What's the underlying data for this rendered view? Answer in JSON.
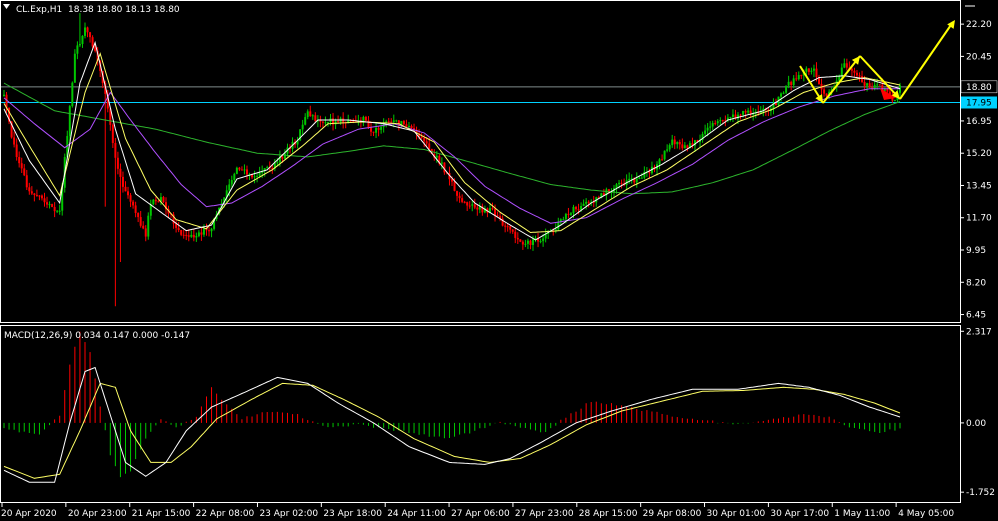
{
  "window": {
    "symbol": "CL.Exp,H1",
    "ohlc": "18.38 18.80 18.13 18.80",
    "menu_icon": "dropdown-triangle-icon"
  },
  "price_axis": {
    "ticks": [
      "22.20",
      "20.45",
      "18.80",
      "16.95",
      "15.20",
      "13.45",
      "11.70",
      "9.95",
      "8.20",
      "6.45"
    ],
    "tick_values": [
      22.2,
      20.45,
      18.8,
      16.95,
      15.2,
      13.45,
      11.7,
      9.95,
      8.2,
      6.45
    ],
    "range": [
      6.1,
      23.4
    ],
    "bid_label": "18.80",
    "bid_value": 18.8,
    "level_label": "17.95",
    "level_value": 17.95
  },
  "macd": {
    "title": "MACD(12,26,9) 0.034 0.147 0.000 -0.147",
    "ticks": [
      "2.317",
      "0.00",
      "-1.752"
    ],
    "tick_values": [
      2.317,
      0.0,
      -1.752
    ],
    "range": [
      -1.95,
      2.4
    ]
  },
  "time_axis": {
    "labels": [
      "20 Apr 2020",
      "20 Apr 23:00",
      "21 Apr 15:00",
      "22 Apr 08:00",
      "23 Apr 02:00",
      "23 Apr 18:00",
      "24 Apr 11:00",
      "27 Apr 06:00",
      "27 Apr 23:00",
      "28 Apr 15:00",
      "29 Apr 08:00",
      "30 Apr 01:00",
      "30 Apr 17:00",
      "1 May 11:00",
      "4 May 05:00"
    ]
  },
  "colors": {
    "background": "#000000",
    "grid_frame": "#ffffff",
    "bull": "#00c800",
    "bear": "#ff0000",
    "level_line": "#00d2ff",
    "bid_line": "#7f8c8d",
    "ma_fast": "#ffffff",
    "ma_mid": "#ffff66",
    "ma_slow": "#b050ff",
    "ma_long": "#2db52d",
    "macd_line": "#ffffff",
    "signal_line": "#ffff66",
    "arrow": "#ffff00"
  },
  "chart_data": {
    "type": "candlestick",
    "anchors": [
      [
        0,
        18.3
      ],
      [
        4,
        15.5
      ],
      [
        10,
        13.0
      ],
      [
        16,
        12.6
      ],
      [
        22,
        12.0
      ],
      [
        28,
        20.5
      ],
      [
        32,
        22.0
      ],
      [
        36,
        20.8
      ],
      [
        40,
        18.5
      ],
      [
        44,
        15.0
      ],
      [
        48,
        13.0
      ],
      [
        52,
        12.0
      ],
      [
        56,
        10.8
      ],
      [
        58,
        12.5
      ],
      [
        62,
        12.8
      ],
      [
        66,
        11.8
      ],
      [
        70,
        10.8
      ],
      [
        76,
        10.7
      ],
      [
        82,
        11.2
      ],
      [
        86,
        12.5
      ],
      [
        92,
        14.3
      ],
      [
        98,
        14.0
      ],
      [
        104,
        14.3
      ],
      [
        110,
        15.0
      ],
      [
        116,
        16.0
      ],
      [
        120,
        17.4
      ],
      [
        124,
        17.0
      ],
      [
        130,
        16.9
      ],
      [
        136,
        17.0
      ],
      [
        142,
        17.1
      ],
      [
        146,
        16.3
      ],
      [
        152,
        17.0
      ],
      [
        158,
        16.8
      ],
      [
        162,
        16.5
      ],
      [
        168,
        15.4
      ],
      [
        172,
        14.8
      ],
      [
        176,
        13.8
      ],
      [
        180,
        12.6
      ],
      [
        186,
        12.3
      ],
      [
        190,
        12.1
      ],
      [
        194,
        12.0
      ],
      [
        198,
        11.2
      ],
      [
        202,
        10.7
      ],
      [
        206,
        10.3
      ],
      [
        212,
        10.5
      ],
      [
        218,
        11.2
      ],
      [
        224,
        12.1
      ],
      [
        230,
        12.4
      ],
      [
        236,
        12.9
      ],
      [
        244,
        13.6
      ],
      [
        252,
        13.9
      ],
      [
        258,
        14.6
      ],
      [
        264,
        15.9
      ],
      [
        270,
        15.5
      ],
      [
        276,
        16.2
      ],
      [
        282,
        17.0
      ],
      [
        288,
        17.2
      ],
      [
        294,
        17.4
      ],
      [
        300,
        17.5
      ],
      [
        304,
        17.8
      ],
      [
        310,
        18.9
      ],
      [
        316,
        19.6
      ],
      [
        320,
        19.7
      ],
      [
        324,
        18.3
      ],
      [
        328,
        18.8
      ],
      [
        332,
        20.0
      ],
      [
        336,
        19.7
      ],
      [
        340,
        19.0
      ],
      [
        344,
        18.8
      ],
      [
        348,
        18.7
      ],
      [
        352,
        18.0
      ],
      [
        354,
        18.8
      ]
    ],
    "ma_fast": [
      [
        0,
        17.6
      ],
      [
        10,
        14.8
      ],
      [
        22,
        12.5
      ],
      [
        30,
        19.0
      ],
      [
        36,
        21.2
      ],
      [
        44,
        16.5
      ],
      [
        52,
        13.0
      ],
      [
        62,
        12.0
      ],
      [
        72,
        11.0
      ],
      [
        82,
        11.3
      ],
      [
        92,
        13.8
      ],
      [
        104,
        14.3
      ],
      [
        116,
        15.9
      ],
      [
        124,
        17.0
      ],
      [
        136,
        17.0
      ],
      [
        150,
        16.8
      ],
      [
        162,
        16.4
      ],
      [
        176,
        14.0
      ],
      [
        186,
        12.5
      ],
      [
        200,
        11.3
      ],
      [
        210,
        10.5
      ],
      [
        220,
        11.3
      ],
      [
        232,
        12.5
      ],
      [
        246,
        13.6
      ],
      [
        260,
        14.6
      ],
      [
        272,
        15.6
      ],
      [
        286,
        17.0
      ],
      [
        300,
        17.5
      ],
      [
        312,
        18.6
      ],
      [
        322,
        19.3
      ],
      [
        332,
        19.4
      ],
      [
        342,
        19.2
      ],
      [
        354,
        18.7
      ]
    ],
    "ma_mid": [
      [
        0,
        17.9
      ],
      [
        10,
        15.6
      ],
      [
        22,
        12.9
      ],
      [
        32,
        18.5
      ],
      [
        38,
        20.6
      ],
      [
        48,
        16.0
      ],
      [
        58,
        13.2
      ],
      [
        68,
        11.6
      ],
      [
        80,
        11.1
      ],
      [
        92,
        13.2
      ],
      [
        106,
        14.3
      ],
      [
        118,
        15.6
      ],
      [
        128,
        16.8
      ],
      [
        142,
        16.9
      ],
      [
        156,
        16.8
      ],
      [
        170,
        15.8
      ],
      [
        182,
        13.6
      ],
      [
        196,
        12.0
      ],
      [
        208,
        10.9
      ],
      [
        220,
        11.0
      ],
      [
        234,
        12.2
      ],
      [
        248,
        13.4
      ],
      [
        262,
        14.3
      ],
      [
        276,
        15.6
      ],
      [
        290,
        16.9
      ],
      [
        304,
        17.6
      ],
      [
        316,
        18.5
      ],
      [
        328,
        19.0
      ],
      [
        340,
        19.3
      ],
      [
        354,
        18.9
      ]
    ],
    "ma_slow": [
      [
        0,
        18.2
      ],
      [
        12,
        16.8
      ],
      [
        24,
        15.5
      ],
      [
        34,
        16.5
      ],
      [
        42,
        18.5
      ],
      [
        50,
        17.0
      ],
      [
        60,
        15.2
      ],
      [
        70,
        13.5
      ],
      [
        80,
        12.3
      ],
      [
        90,
        12.5
      ],
      [
        102,
        13.4
      ],
      [
        114,
        14.5
      ],
      [
        126,
        15.7
      ],
      [
        140,
        16.5
      ],
      [
        154,
        16.8
      ],
      [
        166,
        16.3
      ],
      [
        178,
        15.0
      ],
      [
        190,
        13.4
      ],
      [
        204,
        12.2
      ],
      [
        216,
        11.4
      ],
      [
        230,
        11.7
      ],
      [
        244,
        12.7
      ],
      [
        258,
        13.6
      ],
      [
        272,
        14.6
      ],
      [
        286,
        15.9
      ],
      [
        300,
        16.9
      ],
      [
        314,
        17.7
      ],
      [
        328,
        18.3
      ],
      [
        342,
        18.7
      ],
      [
        354,
        18.7
      ]
    ],
    "ma_long": [
      [
        0,
        19.0
      ],
      [
        20,
        17.5
      ],
      [
        40,
        17.0
      ],
      [
        60,
        16.5
      ],
      [
        80,
        15.8
      ],
      [
        100,
        15.2
      ],
      [
        120,
        15.0
      ],
      [
        136,
        15.3
      ],
      [
        150,
        15.6
      ],
      [
        166,
        15.4
      ],
      [
        182,
        14.8
      ],
      [
        200,
        14.1
      ],
      [
        216,
        13.5
      ],
      [
        232,
        13.2
      ],
      [
        248,
        13.0
      ],
      [
        264,
        13.1
      ],
      [
        280,
        13.6
      ],
      [
        296,
        14.3
      ],
      [
        312,
        15.4
      ],
      [
        326,
        16.4
      ],
      [
        340,
        17.3
      ],
      [
        354,
        18.0
      ]
    ],
    "macd_hist": [
      [
        0,
        -0.15
      ],
      [
        14,
        -0.3
      ],
      [
        22,
        0.2
      ],
      [
        26,
        1.5
      ],
      [
        30,
        2.3
      ],
      [
        34,
        1.8
      ],
      [
        38,
        0.4
      ],
      [
        42,
        -0.8
      ],
      [
        46,
        -1.4
      ],
      [
        50,
        -1.2
      ],
      [
        56,
        -0.4
      ],
      [
        62,
        0.1
      ],
      [
        68,
        -0.1
      ],
      [
        76,
        0.15
      ],
      [
        82,
        0.9
      ],
      [
        86,
        0.6
      ],
      [
        94,
        0.1
      ],
      [
        104,
        0.3
      ],
      [
        116,
        0.2
      ],
      [
        126,
        -0.1
      ],
      [
        140,
        -0.05
      ],
      [
        152,
        -0.15
      ],
      [
        164,
        -0.3
      ],
      [
        176,
        -0.4
      ],
      [
        186,
        -0.2
      ],
      [
        196,
        0.02
      ],
      [
        206,
        -0.15
      ],
      [
        214,
        -0.25
      ],
      [
        222,
        0.15
      ],
      [
        232,
        0.55
      ],
      [
        244,
        0.45
      ],
      [
        254,
        0.3
      ],
      [
        266,
        0.15
      ],
      [
        278,
        0.05
      ],
      [
        290,
        -0.05
      ],
      [
        304,
        0.1
      ],
      [
        316,
        0.2
      ],
      [
        326,
        0.15
      ],
      [
        334,
        -0.1
      ],
      [
        344,
        -0.25
      ],
      [
        354,
        -0.15
      ]
    ],
    "macd_line": [
      [
        0,
        -1.2
      ],
      [
        10,
        -1.5
      ],
      [
        20,
        -1.5
      ],
      [
        26,
        0.0
      ],
      [
        32,
        1.3
      ],
      [
        36,
        1.4
      ],
      [
        42,
        0.2
      ],
      [
        48,
        -1.0
      ],
      [
        56,
        -1.35
      ],
      [
        64,
        -1.0
      ],
      [
        72,
        -0.2
      ],
      [
        82,
        0.4
      ],
      [
        96,
        0.8
      ],
      [
        108,
        1.15
      ],
      [
        120,
        1.0
      ],
      [
        132,
        0.5
      ],
      [
        146,
        0.0
      ],
      [
        160,
        -0.6
      ],
      [
        176,
        -1.0
      ],
      [
        190,
        -1.05
      ],
      [
        200,
        -0.9
      ],
      [
        212,
        -0.5
      ],
      [
        226,
        0.0
      ],
      [
        240,
        0.3
      ],
      [
        256,
        0.6
      ],
      [
        272,
        0.85
      ],
      [
        290,
        0.85
      ],
      [
        306,
        1.0
      ],
      [
        318,
        0.9
      ],
      [
        330,
        0.7
      ],
      [
        342,
        0.4
      ],
      [
        354,
        0.15
      ]
    ],
    "signal_line": [
      [
        0,
        -1.1
      ],
      [
        12,
        -1.4
      ],
      [
        22,
        -1.3
      ],
      [
        30,
        -0.2
      ],
      [
        38,
        1.0
      ],
      [
        44,
        0.9
      ],
      [
        50,
        -0.2
      ],
      [
        58,
        -1.0
      ],
      [
        66,
        -1.0
      ],
      [
        74,
        -0.6
      ],
      [
        84,
        0.1
      ],
      [
        98,
        0.6
      ],
      [
        110,
        1.0
      ],
      [
        122,
        0.95
      ],
      [
        134,
        0.6
      ],
      [
        148,
        0.15
      ],
      [
        162,
        -0.4
      ],
      [
        178,
        -0.85
      ],
      [
        192,
        -1.0
      ],
      [
        204,
        -0.9
      ],
      [
        216,
        -0.55
      ],
      [
        230,
        -0.05
      ],
      [
        244,
        0.3
      ],
      [
        260,
        0.55
      ],
      [
        276,
        0.8
      ],
      [
        292,
        0.82
      ],
      [
        308,
        0.9
      ],
      [
        320,
        0.85
      ],
      [
        332,
        0.72
      ],
      [
        344,
        0.5
      ],
      [
        354,
        0.25
      ]
    ]
  }
}
